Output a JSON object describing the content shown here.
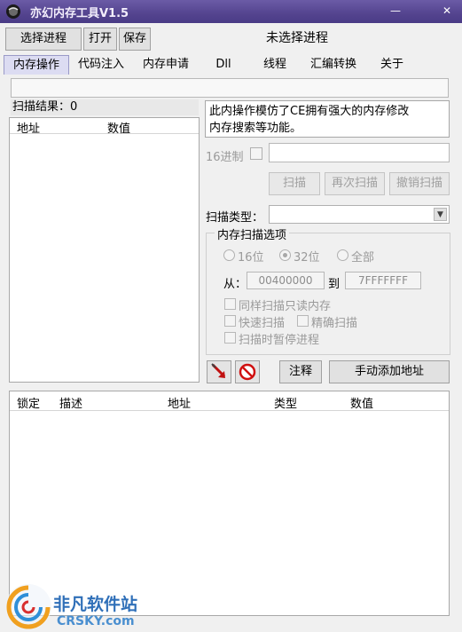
{
  "window": {
    "title": "亦幻内存工具V1.5",
    "minimize": "—",
    "close": "✕"
  },
  "toolbar": {
    "select_process": "选择进程",
    "open": "打开",
    "save": "保存"
  },
  "process_status": "未选择进程",
  "tabs": [
    "内存操作",
    "代码注入",
    "内存申请",
    "Dll",
    "线程",
    "汇编转换",
    "关于"
  ],
  "scan": {
    "result_label": "扫描结果：0",
    "columns": [
      "地址",
      "数值"
    ],
    "info_text_line1": "此内操作模仿了CE拥有强大的内存修改",
    "info_text_line2": "内存搜索等功能。",
    "hex_label": "16进制",
    "value_input": "",
    "scan_button": "扫描",
    "rescan_button": "再次扫描",
    "undo_button": "撤销扫描",
    "type_label": "扫描类型：",
    "type_value": ""
  },
  "options": {
    "title": "内存扫描选项",
    "radio_16": "16位",
    "radio_32": "32位",
    "radio_all": "全部",
    "selected_width": "32位",
    "from_label": "从：",
    "from_value": "00400000",
    "to_label": "到",
    "to_value": "7FFFFFFF",
    "cb_readonly": "同样扫描只读内存",
    "cb_fast": "快速扫描",
    "cb_exact": "精确扫描",
    "cb_pause": "扫描时暂停进程"
  },
  "actions": {
    "comment_button": "注释",
    "add_address_button": "手动添加地址"
  },
  "address_list": {
    "columns": [
      "锁定",
      "描述",
      "地址",
      "类型",
      "数值"
    ]
  },
  "watermark": {
    "brand_cn": "非凡软件站",
    "brand_en": "CRSKY.com"
  },
  "colors": {
    "titlebar": "#54448f",
    "accent_red": "#d01010",
    "watermark_blue": "#2f6fb8"
  }
}
